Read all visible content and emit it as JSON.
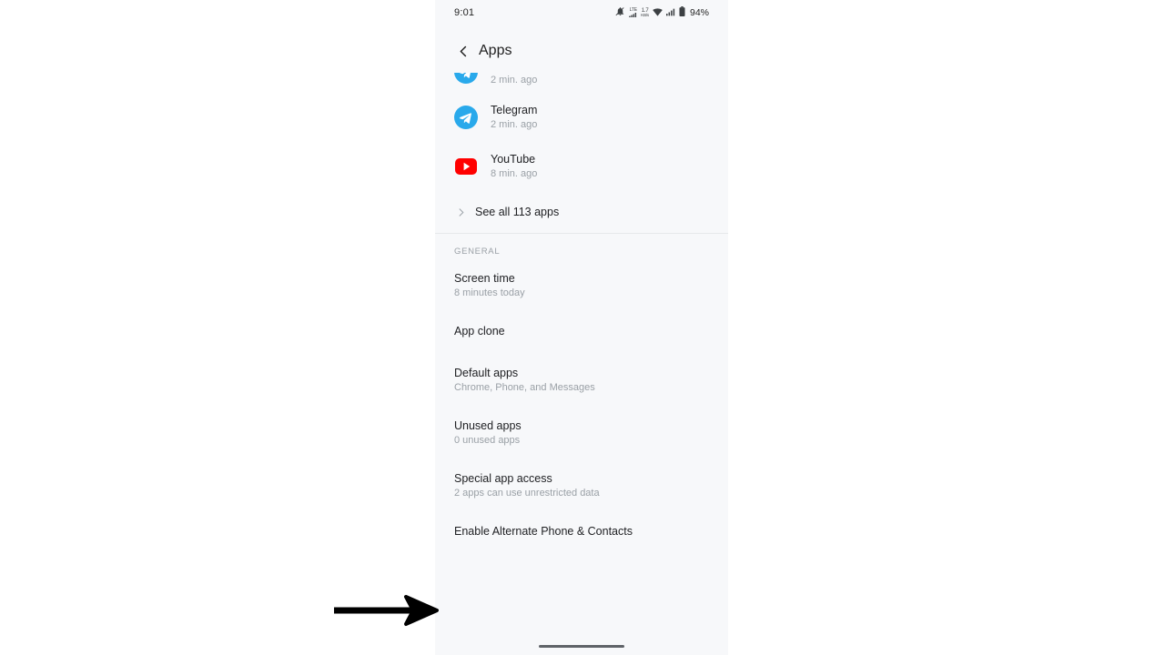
{
  "status_bar": {
    "clock": "9:01",
    "icons": [
      {
        "name": "notification-silenced-icon",
        "glyph": "bell-slash"
      },
      {
        "name": "lte-signal-icon",
        "glyph": "lte",
        "label": "LTE"
      },
      {
        "name": "network-speed-icon",
        "glyph": "speed",
        "value": "1.7",
        "unit": "KB/s"
      },
      {
        "name": "wifi-icon",
        "glyph": "wifi"
      },
      {
        "name": "cellular-signal-icon",
        "glyph": "bars"
      },
      {
        "name": "battery-icon",
        "glyph": "battery"
      }
    ],
    "battery_percent": "94%"
  },
  "app_bar": {
    "back_icon": "chevron-left-icon",
    "title": "Apps"
  },
  "recent_apps": {
    "items": [
      {
        "name": "",
        "time": "2 min. ago",
        "icon": "app-icon-clipped",
        "clipped": true
      },
      {
        "name": "Telegram",
        "time": "2 min. ago",
        "icon": "telegram-icon",
        "clipped": false
      },
      {
        "name": "YouTube",
        "time": "8 min. ago",
        "icon": "youtube-icon",
        "clipped": false
      }
    ],
    "see_all_label": "See all 113 apps",
    "see_all_icon": "chevron-right-icon"
  },
  "general_section": {
    "header": "GENERAL",
    "rows": [
      {
        "title": "Screen time",
        "subtitle": "8 minutes today"
      },
      {
        "title": "App clone",
        "subtitle": ""
      },
      {
        "title": "Default apps",
        "subtitle": "Chrome, Phone, and Messages"
      },
      {
        "title": "Unused apps",
        "subtitle": "0 unused apps"
      },
      {
        "title": "Special app access",
        "subtitle": "2 apps can use unrestricted data"
      },
      {
        "title": "Enable Alternate Phone & Contacts",
        "subtitle": ""
      }
    ]
  },
  "navigation": {
    "gesture_handle": "home-gesture-bar"
  },
  "annotation": {
    "arrow": "pointer-arrow-right",
    "target": "Enable Alternate Phone & Contacts"
  },
  "colors": {
    "screen_bg": "#f7f8fa",
    "page_bg": "#ffffff",
    "text_primary": "#202124",
    "text_secondary": "#9aa0a6",
    "telegram_blue": "#29a9eb",
    "youtube_red": "#ff0000",
    "divider": "#e6e8eb",
    "annotation_black": "#000000"
  }
}
